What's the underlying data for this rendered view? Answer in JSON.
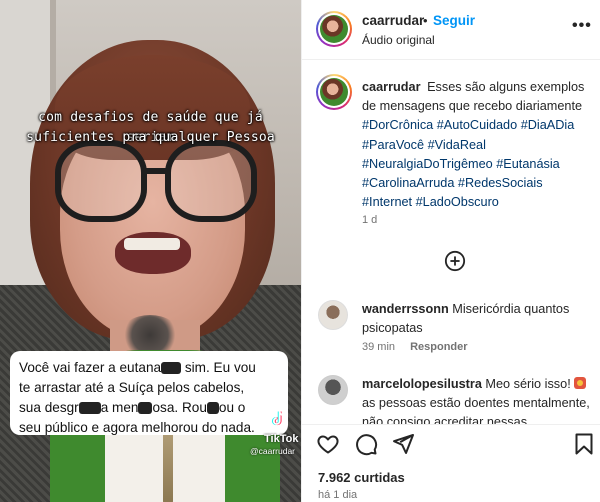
{
  "video": {
    "overlay_line1": "com desafios de saúde que já seriam",
    "overlay_line2": "suficientes pra qualquer Pessoa",
    "comment_card": {
      "seg1": "Você vai fazer a eutana",
      "seg2": " sim. Eu vou",
      "seg3": "te arrastar até a Suíça pelos cabelos,",
      "seg4": "sua desgr",
      "seg5": "a men",
      "seg6": "osa. Rou",
      "seg7": "ou o",
      "seg8": "seu público e agora melhorou do nada."
    },
    "watermark_label": "TikTok",
    "watermark_user": "@caarrudar"
  },
  "header": {
    "username": "caarrudar",
    "separator": "•",
    "follow_label": "Seguir",
    "audio_label": "Áudio original",
    "more_label": "•••"
  },
  "caption": {
    "username": "caarrudar",
    "text": "Esses são alguns exemplos de mensagens que recebo diariamente",
    "hashtags": [
      "#DorCrônica",
      "#AutoCuidado",
      "#DiaADia",
      "#ParaVocê",
      "#VidaReal",
      "#NeuralgiaDoTrigêmeo",
      "#Eutanásia",
      "#CarolinaArruda",
      "#RedesSociais",
      "#Internet",
      "#LadoObscuro"
    ],
    "time": "1 d"
  },
  "comments": [
    {
      "username": "wanderrssonn",
      "text": "Misericórdia quantos psicopatas",
      "time": "39 min",
      "reply_label": "Responder"
    },
    {
      "username": "marcelolopesilustra",
      "text_before_emoji": "Meo sério isso!",
      "text_after_emoji": "as pessoas estão doentes mentalmente, não consigo acreditar nessas mensagens"
    }
  ],
  "actions": {
    "icons": [
      "heart-icon",
      "comment-icon",
      "share-icon",
      "bookmark-icon"
    ],
    "likes": "7.962 curtidas",
    "posted": "há 1 dia"
  },
  "colors": {
    "link_blue": "#0095f6",
    "hashtag": "#00376b",
    "muted": "#737373"
  }
}
